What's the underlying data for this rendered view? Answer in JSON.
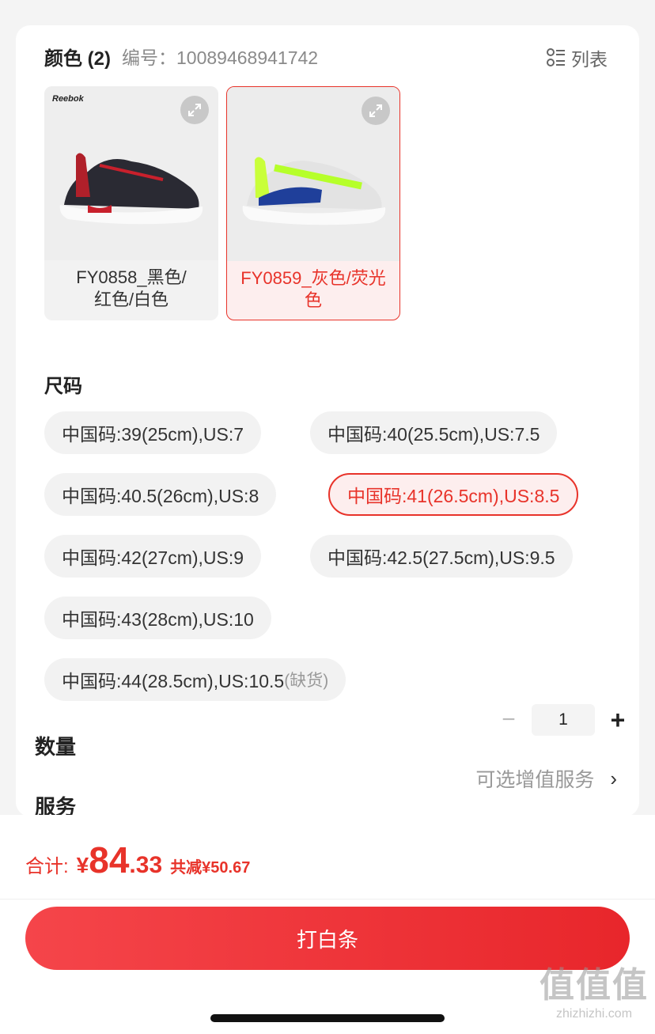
{
  "color_section": {
    "title": "颜色 (2)",
    "code_label": "编号：",
    "code_value": "10089468941742",
    "list_toggle_label": "列表"
  },
  "color_options": [
    {
      "brand": "Reebok",
      "label_line1": "FY0858_黑色/",
      "label_line2": "红色/白色",
      "selected": false
    },
    {
      "label_line1": "FY0859_灰色/荧光",
      "label_line2": "色",
      "selected": true
    }
  ],
  "size_section": {
    "title": "尺码",
    "options": [
      {
        "label": "中国码:39(25cm),US:7",
        "selected": false
      },
      {
        "label": "中国码:40(25.5cm),US:7.5",
        "selected": false
      },
      {
        "label": "中国码:40.5(26cm),US:8",
        "selected": false
      },
      {
        "label": "中国码:41(26.5cm),US:8.5",
        "selected": true
      },
      {
        "label": "中国码:42(27cm),US:9",
        "selected": false
      },
      {
        "label": "中国码:42.5(27.5cm),US:9.5",
        "selected": false
      },
      {
        "label": "中国码:43(28cm),US:10",
        "selected": false
      },
      {
        "label": "中国码:44(28.5cm),US:10.5",
        "suffix": "(缺货)",
        "selected": false
      }
    ]
  },
  "quantity": {
    "label": "数量",
    "value": "1",
    "minus": "−",
    "plus": "+"
  },
  "service": {
    "label": "服务",
    "value": "可选增值服务",
    "chevron": "›"
  },
  "footer": {
    "total_label": "合计:",
    "currency": "¥",
    "price_int": "84",
    "price_dec": ".33",
    "discount": "共减¥50.67",
    "cta_label": "打白条"
  },
  "watermark": {
    "big": "值值值",
    "small": "zhizhizhi.com"
  },
  "colors": {
    "accent": "#e8332a",
    "chip_bg": "#f2f2f2"
  }
}
